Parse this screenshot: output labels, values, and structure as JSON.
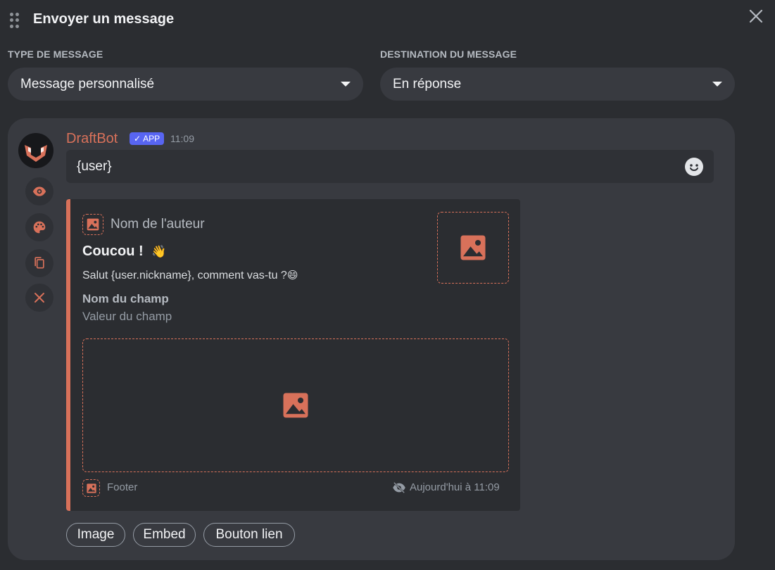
{
  "header": {
    "title": "Envoyer un message"
  },
  "message_type": {
    "label": "TYPE DE MESSAGE",
    "selected": "Message personnalisé"
  },
  "destination": {
    "label": "DESTINATION DU MESSAGE",
    "selected": "En réponse"
  },
  "preview": {
    "bot_name": "DraftBot",
    "badge": "APP",
    "time": "11:09",
    "content": "{user}"
  },
  "embed": {
    "author": "Nom de l'auteur",
    "title": "Coucou !",
    "title_emoji": "👋",
    "description": "Salut {user.nickname}, comment vas-tu ?",
    "description_emoji": "😄",
    "field_name": "Nom du champ",
    "field_value": "Valeur du champ",
    "footer": "Footer",
    "timestamp": "Aujourd'hui à 11:09",
    "color": "#d8715a"
  },
  "buttons": [
    "Image",
    "Embed",
    "Bouton lien"
  ],
  "icons": {
    "side": [
      "eye-icon",
      "palette-icon",
      "copy-icon",
      "close-icon"
    ]
  }
}
